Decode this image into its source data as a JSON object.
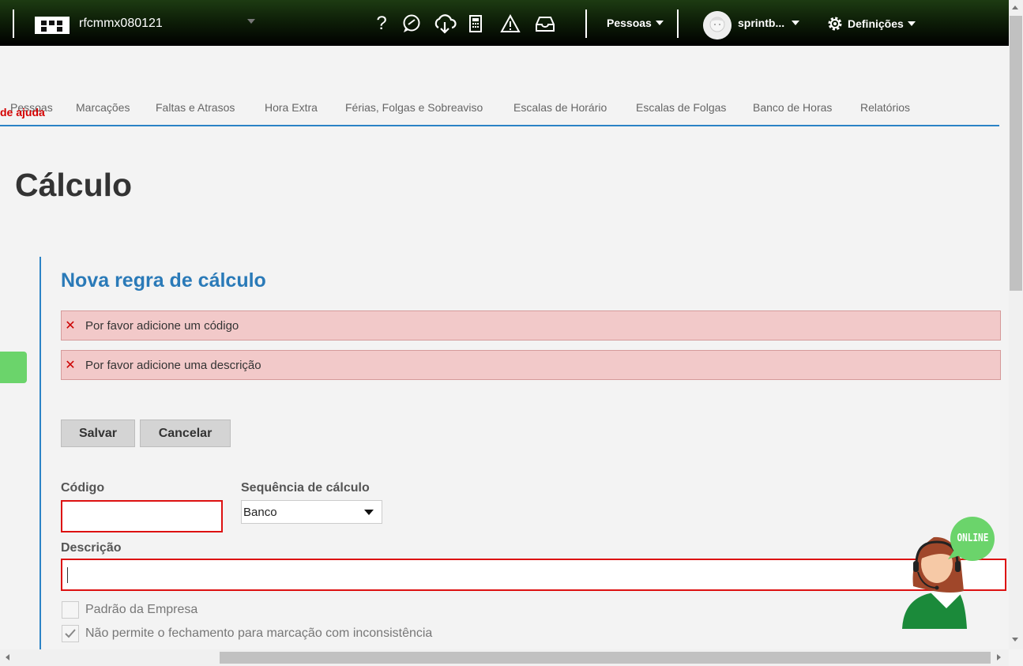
{
  "topbar": {
    "account_name": "rfcmmx080121",
    "people_menu": "Pessoas",
    "user_name": "sprintb...",
    "settings_menu": "Definições"
  },
  "nav": {
    "items": [
      "Pessoas",
      "Marcações",
      "Faltas e Atrasos",
      "Hora Extra",
      "Férias, Folgas e Sobreaviso",
      "Escalas de Horário",
      "Escalas de Folgas",
      "Banco de Horas",
      "Relatórios"
    ],
    "help_overlay": "de ajuda"
  },
  "page": {
    "title": "Cálculo",
    "section_title": "Nova regra de cálculo"
  },
  "alerts": [
    "Por favor adicione um código",
    "Por favor adicione uma descrição"
  ],
  "buttons": {
    "save": "Salvar",
    "cancel": "Cancelar"
  },
  "form": {
    "code_label": "Código",
    "code_value": "",
    "sequence_label": "Sequência de cálculo",
    "sequence_value": "Banco",
    "description_label": "Descrição",
    "description_value": "",
    "company_default_label": "Padrão da Empresa",
    "company_default_checked": false,
    "no_close_label": "Não permite o fechamento para marcação com inconsistência",
    "no_close_checked": true
  },
  "chat": {
    "status": "ONLINE"
  },
  "colors": {
    "accent": "#2b83c6",
    "error": "#d11111",
    "error_bg": "#f2c9c9",
    "online": "#6bd46b"
  }
}
